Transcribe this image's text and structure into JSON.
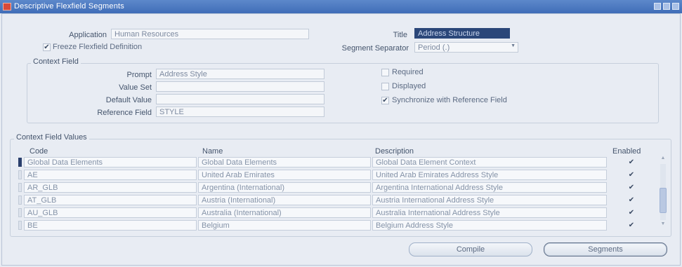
{
  "window": {
    "title": "Descriptive Flexfield Segments"
  },
  "header": {
    "application_label": "Application",
    "application_value": "Human Resources",
    "title_label": "Title",
    "title_value": "Address Structure",
    "freeze_label": "Freeze Flexfield Definition",
    "freeze_checked": true,
    "separator_label": "Segment Separator",
    "separator_value": "Period (.)"
  },
  "context_field": {
    "group_label": "Context Field",
    "prompt_label": "Prompt",
    "prompt_value": "Address Style",
    "value_set_label": "Value Set",
    "value_set_value": "",
    "default_value_label": "Default Value",
    "default_value_value": "",
    "reference_field_label": "Reference Field",
    "reference_field_value": "STYLE",
    "required_label": "Required",
    "required_checked": false,
    "displayed_label": "Displayed",
    "displayed_checked": false,
    "synchronize_label": "Synchronize with Reference Field",
    "synchronize_checked": true
  },
  "context_values": {
    "group_label": "Context Field Values",
    "columns": {
      "code": "Code",
      "name": "Name",
      "description": "Description",
      "enabled": "Enabled"
    },
    "rows": [
      {
        "code": "Global Data Elements",
        "name": "Global Data Elements",
        "description": "Global Data Element Context",
        "enabled": true
      },
      {
        "code": "AE",
        "name": "United Arab Emirates",
        "description": "United Arab Emirates Address Style",
        "enabled": true
      },
      {
        "code": "AR_GLB",
        "name": "Argentina (International)",
        "description": "Argentina International Address Style",
        "enabled": true
      },
      {
        "code": "AT_GLB",
        "name": "Austria (International)",
        "description": "Austria International Address Style",
        "enabled": true
      },
      {
        "code": "AU_GLB",
        "name": "Australia (International)",
        "description": "Australia International Address Style",
        "enabled": true
      },
      {
        "code": "BE",
        "name": "Belgium",
        "description": "Belgium Address Style",
        "enabled": true
      }
    ]
  },
  "buttons": {
    "compile": "Compile",
    "segments": "Segments"
  },
  "icons": {
    "checkmark": "✔",
    "dropdown": "▼",
    "scroll_up": "▲",
    "scroll_down": "▼"
  }
}
